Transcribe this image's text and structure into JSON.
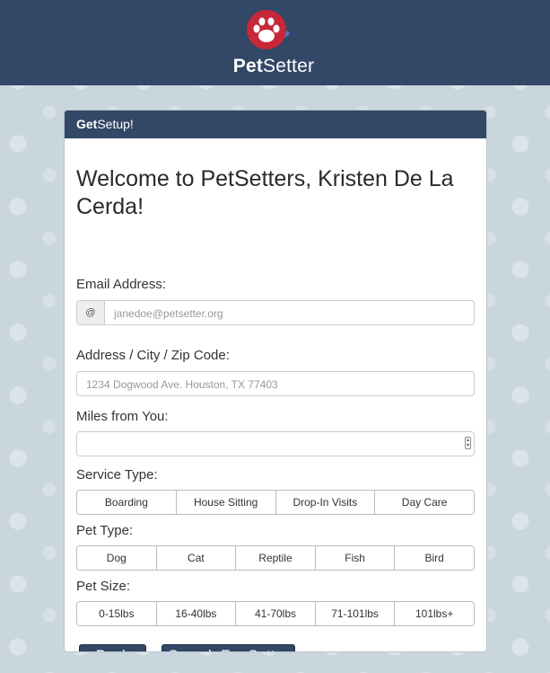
{
  "brand": {
    "name_bold": "Pet",
    "name_rest": "Setter"
  },
  "card": {
    "header_bold": "Get",
    "header_rest": "Setup!",
    "welcome": "Welcome to PetSetters, Kristen De La Cerda!"
  },
  "form": {
    "email_label": "Email Address:",
    "email_addon": "@",
    "email_placeholder": "janedoe@petsetter.org",
    "address_label": "Address / City / Zip Code:",
    "address_placeholder": "1234 Dogwood Ave. Houston, TX 77403",
    "miles_label": "Miles from You:",
    "miles_value": "",
    "service_label": "Service Type:",
    "service_options": [
      "Boarding",
      "House Sitting",
      "Drop-In Visits",
      "Day Care"
    ],
    "pet_type_label": "Pet Type:",
    "pet_types": [
      "Dog",
      "Cat",
      "Reptile",
      "Fish",
      "Bird"
    ],
    "pet_size_label": "Pet Size:",
    "pet_sizes": [
      "0-15lbs",
      "16-40lbs",
      "41-70lbs",
      "71-101lbs",
      "101lbs+"
    ]
  },
  "actions": {
    "back": "Back",
    "search": "Search For Setter"
  },
  "colors": {
    "navy": "#334766",
    "paw_red": "#c8273a",
    "page_bg": "#c9d6de"
  }
}
